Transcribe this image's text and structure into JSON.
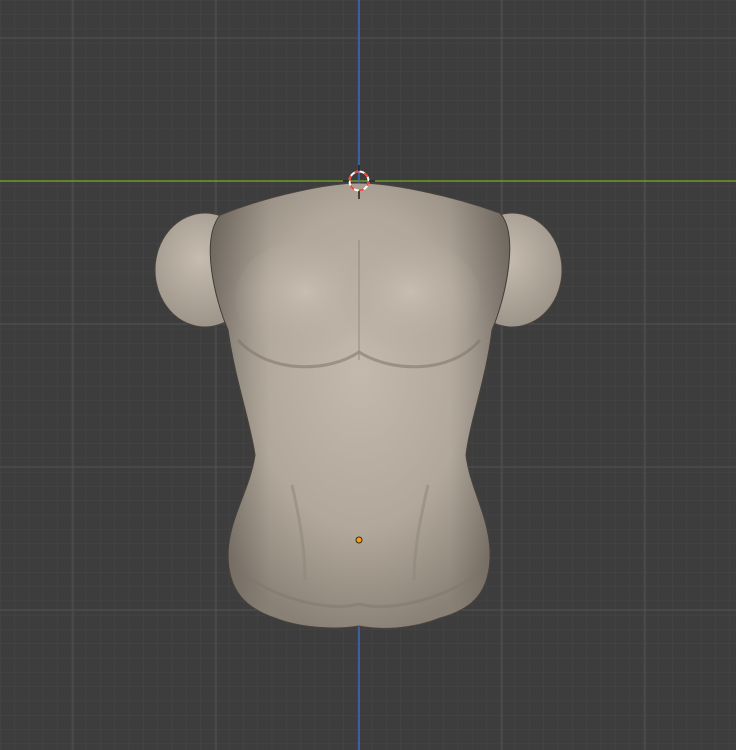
{
  "viewport": {
    "background_color": "#3d3d3d",
    "grid_minor_color": "#474747",
    "grid_major_color": "#525252",
    "x_axis_color": "#6e9a2a",
    "z_axis_color": "#3b6cc4",
    "mesh_color": "#b3a99d",
    "origin_color": "#f29e1a",
    "cursor_colors": [
      "#e84a3a",
      "#ffffff"
    ]
  },
  "objects": [
    {
      "name": "torso-mesh",
      "selected": false
    }
  ],
  "icons": {
    "cursor": "3d-cursor-icon",
    "origin": "object-origin-icon"
  }
}
